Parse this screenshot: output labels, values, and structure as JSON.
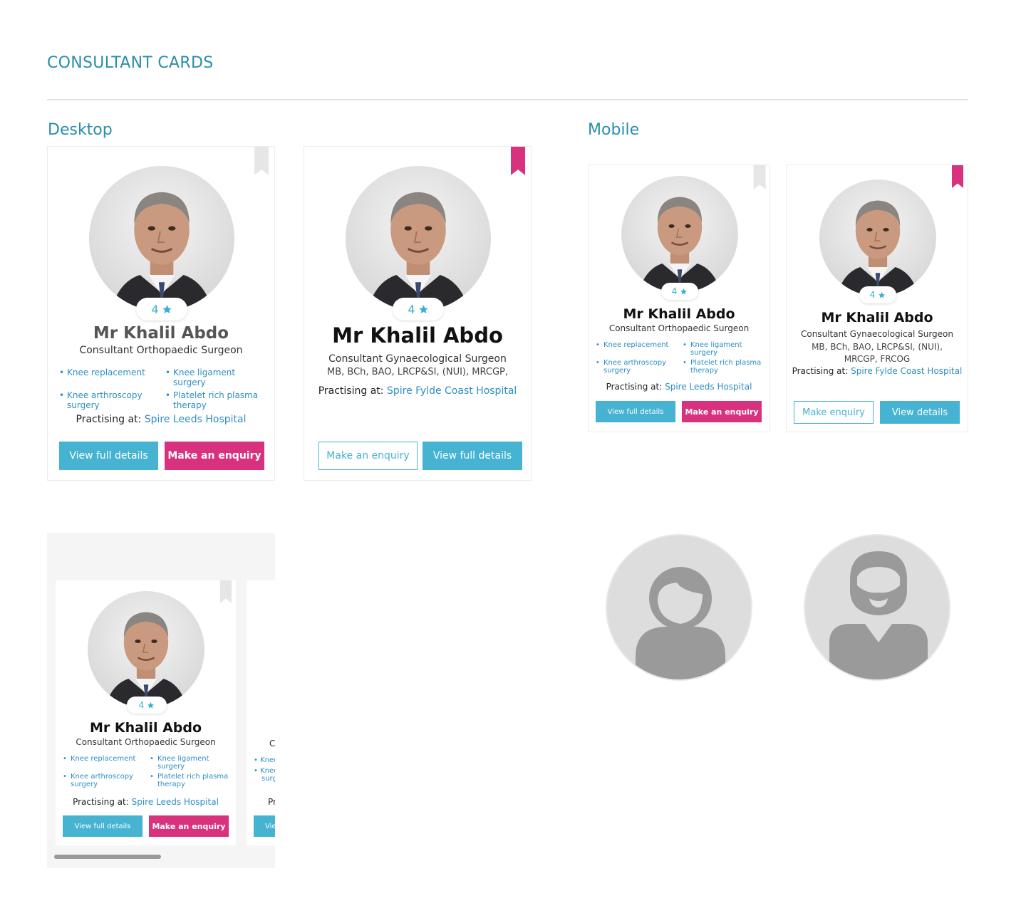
{
  "page": {
    "title": "CONSULTANT CARDS",
    "desktop_heading": "Desktop",
    "mobile_heading": "Mobile"
  },
  "colors": {
    "accent": "#2a8ea8",
    "button_blue": "#45b3d1",
    "button_pink": "#d8327e",
    "link": "#2d8fc4",
    "bookmark_inactive": "#e6e6e6",
    "bookmark_active": "#d8327e"
  },
  "icons": {
    "rating": "star-icon",
    "bookmark": "bookmark-icon",
    "placeholder_female": "female-avatar-icon",
    "placeholder_male": "male-avatar-icon"
  },
  "desktop_card_1": {
    "rating": "4",
    "name": "Mr Khalil Abdo",
    "role": "Consultant Orthopaedic Surgeon",
    "specialities": [
      "Knee replacement",
      "Knee ligament surgery",
      "Knee arthroscopy surgery",
      "Platelet rich plasma therapy"
    ],
    "practising_label": "Practising at: ",
    "hospital": "Spire Leeds Hospital",
    "primary_button": "View full details",
    "secondary_button": "Make an enquiry",
    "bookmarked": false
  },
  "desktop_card_2": {
    "rating": "4",
    "name": "Mr Khalil Abdo",
    "role": "Consultant Gynaecological Surgeon",
    "qualifications": "MB, BCh, BAO, LRCP&SI, (NUI), MRCGP,",
    "practising_label": "Practising at: ",
    "hospital": "Spire Fylde Coast Hospital",
    "primary_button": "Make an enquiry",
    "secondary_button": "View full details",
    "bookmarked": true
  },
  "mobile_card_1": {
    "rating": "4",
    "name": "Mr Khalil Abdo",
    "role": "Consultant Orthopaedic Surgeon",
    "specialities": [
      "Knee replacement",
      "Knee ligament surgery",
      "Knee arthroscopy surgery",
      "Platelet rich plasma therapy"
    ],
    "practising_label": "Practising at: ",
    "hospital": "Spire Leeds Hospital",
    "primary_button": "View full details",
    "secondary_button": "Make an enquiry",
    "bookmarked": false
  },
  "mobile_card_2": {
    "rating": "4",
    "name": "Mr Khalil Abdo",
    "role": "Consultant Gynaecological Surgeon",
    "qualifications": "MB, BCh, BAO, LRCP&SI, (NUI), MRCGP, FRCOG",
    "practising_label": "Practising at: ",
    "hospital": "Spire Fylde Coast Hospital",
    "primary_button": "Make enquiry",
    "secondary_button": "View details",
    "bookmarked": true
  },
  "carousel_card": {
    "rating": "4",
    "name": "Mr Khalil Abdo",
    "role": "Consultant Orthopaedic Surgeon",
    "specialities": [
      "Knee replacement",
      "Knee ligament surgery",
      "Knee arthroscopy surgery",
      "Platelet rich plasma therapy"
    ],
    "practising_label": "Practising at: ",
    "hospital": "Spire Leeds Hospital",
    "primary_button": "View full details",
    "secondary_button": "Make an enquiry",
    "bookmarked": false
  },
  "carousel_peek": {
    "role_fragment": "C",
    "spec_fragment_1": "Knee",
    "spec_fragment_2": "Knee",
    "spec_fragment_3": "surg",
    "practising_fragment": "Pr",
    "button_fragment": "Vie"
  }
}
